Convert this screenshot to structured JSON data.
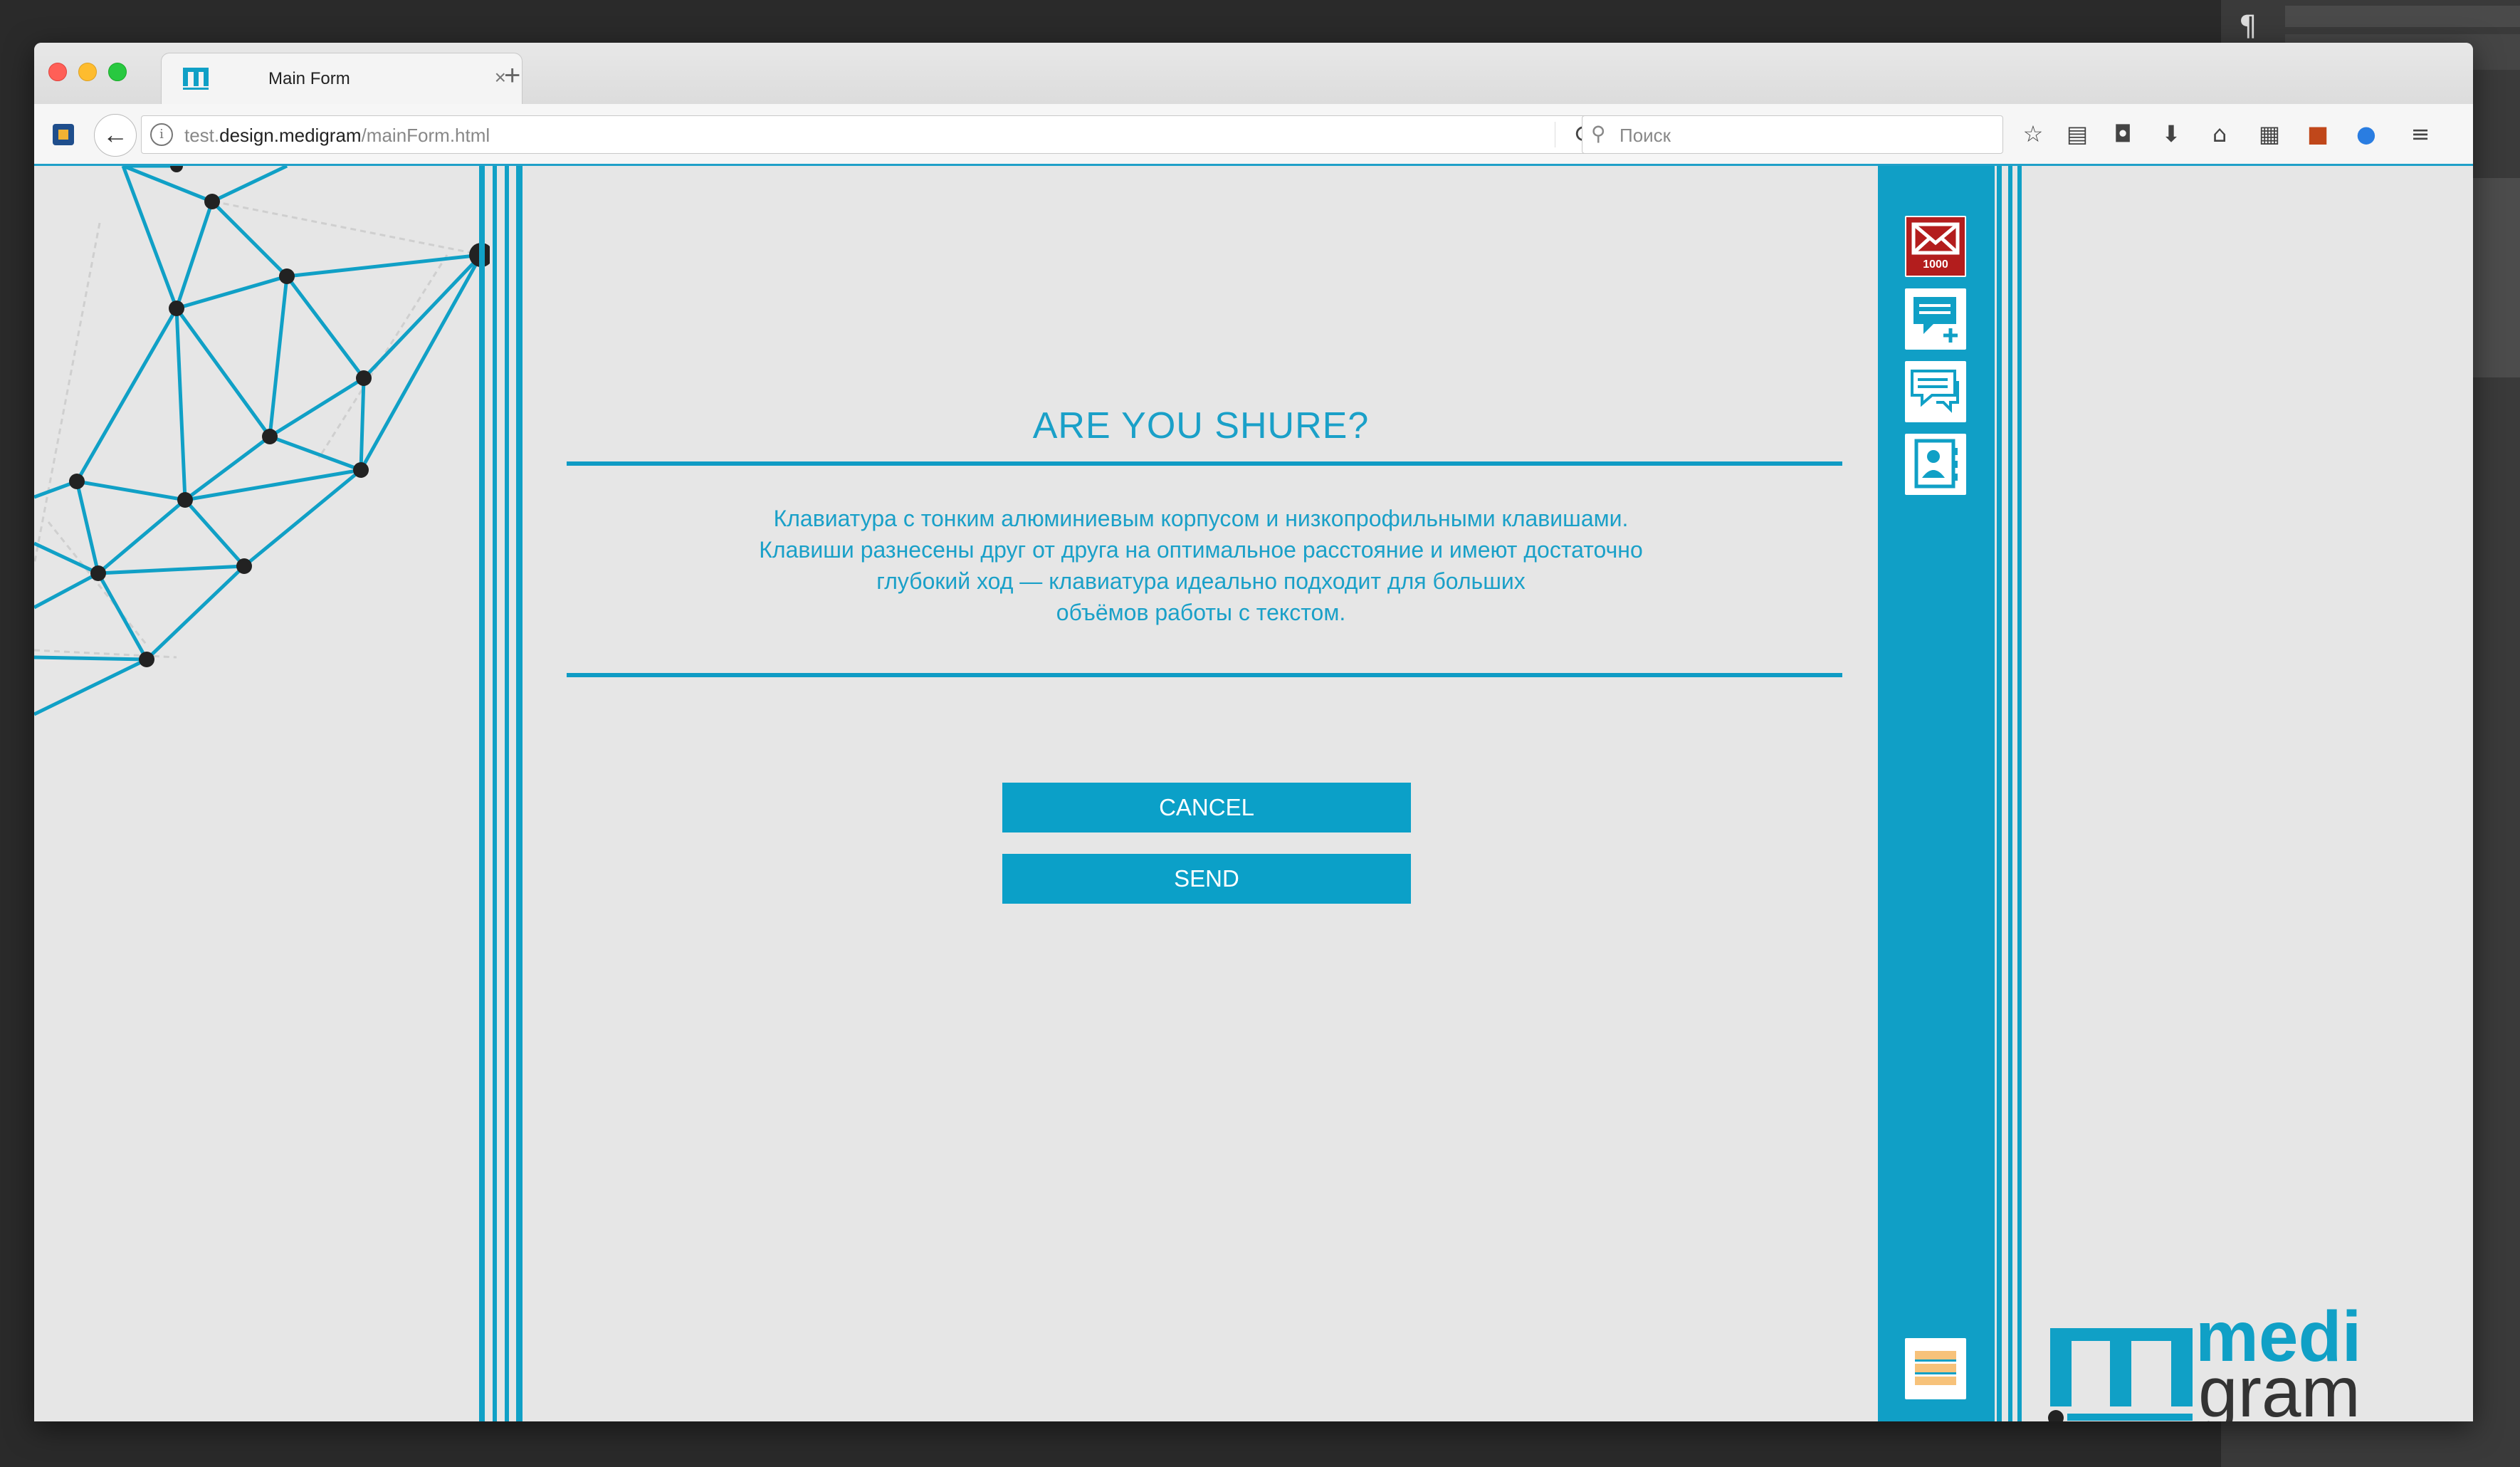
{
  "browser": {
    "tab_title": "Main Form",
    "tab_close": "×",
    "new_tab": "+",
    "url_prefix": "test.",
    "url_domain": "design.medigram",
    "url_path": "/mainForm.html",
    "search_placeholder": "Поиск"
  },
  "dialog": {
    "title": "ARE YOU SHURE?",
    "body": "Клавиатура с тонким алюминиевым корпусом и низкопрофильными клавишами.\nКлавиши разнесены друг от друга на оптимальное расстояние и имеют достаточно\nглубокий ход — клавиатура идеально подходит для больших\nобъёмов работы с текстом.",
    "cancel_label": "CANCEL",
    "send_label": "SEND"
  },
  "sidebar": {
    "mail_count": "1000",
    "items": [
      {
        "icon": "mail-icon"
      },
      {
        "icon": "new-message-icon"
      },
      {
        "icon": "messages-icon"
      },
      {
        "icon": "contacts-icon"
      },
      {
        "icon": "menu-icon"
      }
    ]
  },
  "logo": {
    "line1": "medi",
    "line2": "gram"
  },
  "colors": {
    "accent": "#10a0c6",
    "mail_badge": "#b31d1d",
    "page_bg": "#e6e6e6"
  }
}
